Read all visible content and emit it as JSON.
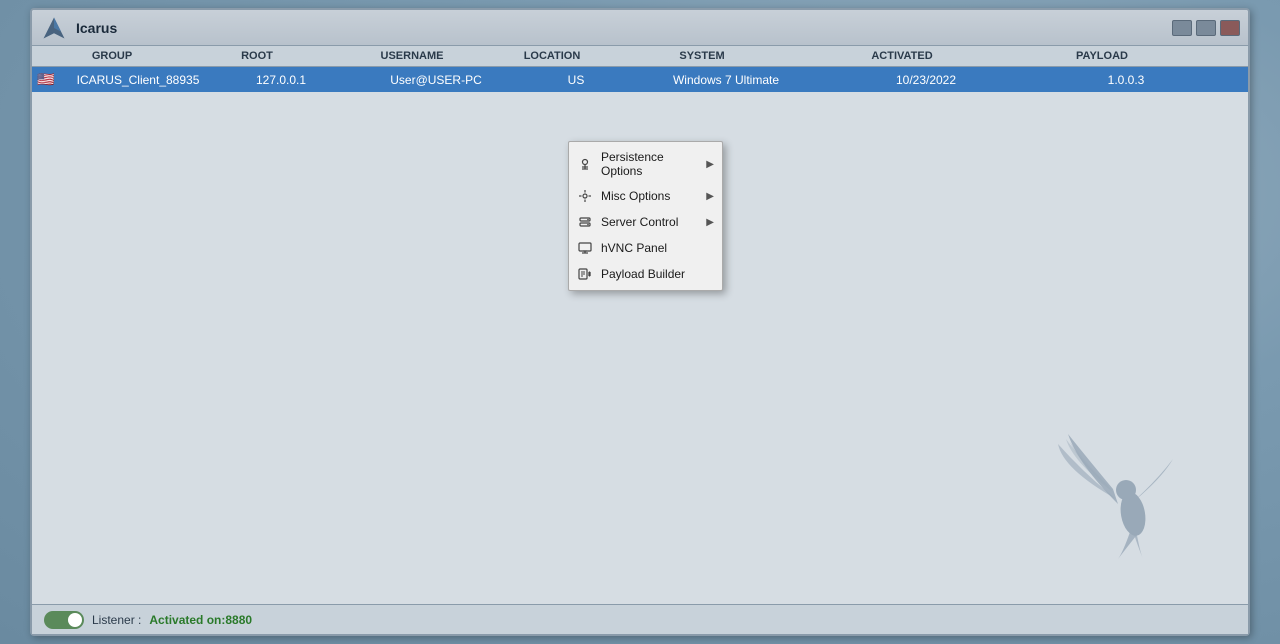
{
  "app": {
    "title": "Icarus",
    "titlebar_buttons": [
      "minimize",
      "maximize",
      "close"
    ]
  },
  "table": {
    "columns": [
      "GROUP",
      "ROOT",
      "USERNAME",
      "LOCATION",
      "SYSTEM",
      "ACTIVATED",
      "PAYLOAD"
    ],
    "rows": [
      {
        "flag": "🇺🇸",
        "group": "ICARUS_Client_88935",
        "root": "127.0.0.1",
        "username": "User@USER-PC",
        "location": "US",
        "system": "Windows 7 Ultimate",
        "activated": "10/23/2022",
        "payload": "1.0.0.3"
      }
    ]
  },
  "context_menu": {
    "items": [
      {
        "id": "persistence-options",
        "label": "Persistence Options",
        "has_arrow": true
      },
      {
        "id": "misc-options",
        "label": "Misc Options",
        "has_arrow": true
      },
      {
        "id": "server-control",
        "label": "Server Control",
        "has_arrow": true
      },
      {
        "id": "hvnc-panel",
        "label": "hVNC Panel",
        "has_arrow": false
      },
      {
        "id": "payload-builder",
        "label": "Payload Builder",
        "has_arrow": false
      }
    ]
  },
  "statusbar": {
    "listener_label": "Listener :",
    "listener_value": "Activated on:8880"
  }
}
